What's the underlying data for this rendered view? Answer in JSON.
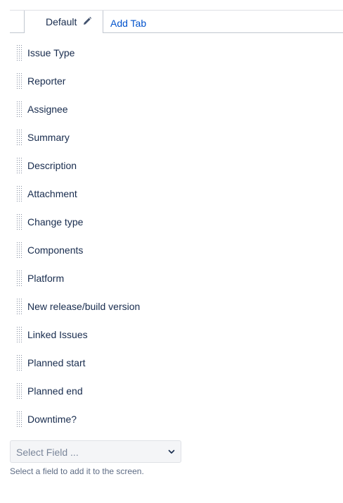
{
  "tabs": {
    "active_tab_label": "Default",
    "add_tab_label": "Add Tab",
    "edit_icon": "pencil-icon"
  },
  "fields": [
    {
      "label": "Issue Type"
    },
    {
      "label": "Reporter"
    },
    {
      "label": "Assignee"
    },
    {
      "label": "Summary"
    },
    {
      "label": "Description"
    },
    {
      "label": "Attachment"
    },
    {
      "label": "Change type"
    },
    {
      "label": "Components"
    },
    {
      "label": "Platform"
    },
    {
      "label": "New release/build version"
    },
    {
      "label": "Linked Issues"
    },
    {
      "label": "Planned start"
    },
    {
      "label": "Planned end"
    },
    {
      "label": "Downtime?"
    }
  ],
  "field_picker": {
    "placeholder": "Select Field ...",
    "help_text": "Select a field to add it to the screen."
  },
  "colors": {
    "link": "#0052cc",
    "text": "#172b4d",
    "muted": "#5e6c84"
  }
}
